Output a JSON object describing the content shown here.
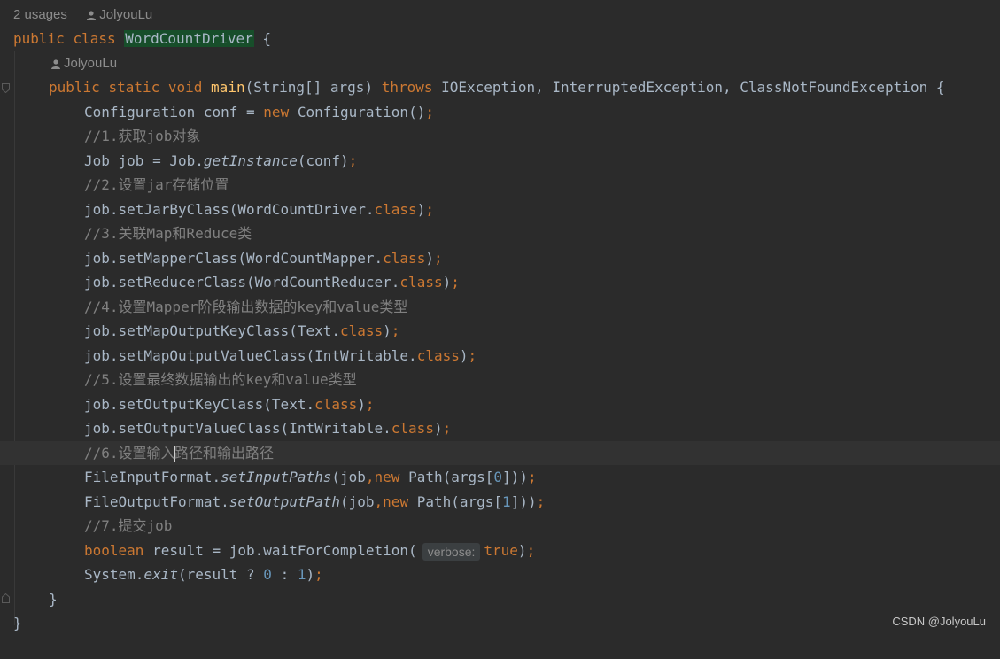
{
  "class_hint": {
    "usages": "2 usages",
    "author": "JolyouLu"
  },
  "method_hint": {
    "author": "JolyouLu"
  },
  "code": {
    "class_decl": {
      "kw1": "public",
      "kw2": "class",
      "name": "WordCountDriver",
      "brace": " {"
    },
    "main_decl": {
      "kw1": "public",
      "kw2": "static",
      "kw3": "void",
      "name": "main",
      "params": "(String[] args) ",
      "throws": "throws",
      "exceptions": " IOException, InterruptedException, ClassNotFoundException {"
    },
    "l_conf": {
      "a": "Configuration conf = ",
      "kw": "new",
      "b": " Configuration()",
      "semi": ";"
    },
    "c1": "//1.获取job对象",
    "l_job": {
      "a": "Job job = Job.",
      "method": "getInstance",
      "b": "(conf)",
      "semi": ";"
    },
    "c2": "//2.设置jar存储位置",
    "l_jar": {
      "a": "job.setJarByClass(WordCountDriver.",
      "kw": "class",
      "b": ")",
      "semi": ";"
    },
    "c3": "//3.关联Map和Reduce类",
    "l_mapper": {
      "a": "job.setMapperClass(WordCountMapper.",
      "kw": "class",
      "b": ")",
      "semi": ";"
    },
    "l_reducer": {
      "a": "job.setReducerClass(WordCountReducer.",
      "kw": "class",
      "b": ")",
      "semi": ";"
    },
    "c4": "//4.设置Mapper阶段输出数据的key和value类型",
    "l_mok": {
      "a": "job.setMapOutputKeyClass(Text.",
      "kw": "class",
      "b": ")",
      "semi": ";"
    },
    "l_mov": {
      "a": "job.setMapOutputValueClass(IntWritable.",
      "kw": "class",
      "b": ")",
      "semi": ";"
    },
    "c5": "//5.设置最终数据输出的key和value类型",
    "l_ok": {
      "a": "job.setOutputKeyClass(Text.",
      "kw": "class",
      "b": ")",
      "semi": ";"
    },
    "l_ov": {
      "a": "job.setOutputValueClass(IntWritable.",
      "kw": "class",
      "b": ")",
      "semi": ";"
    },
    "c6a": "//6.设置输入",
    "c6b": "路径和输出路径",
    "l_in": {
      "a": "FileInputFormat.",
      "method": "setInputPaths",
      "b": "(job",
      "comma": ",",
      "kw": "new",
      "c": " Path(args[",
      "num": "0",
      "d": "]))",
      "semi": ";"
    },
    "l_out": {
      "a": "FileOutputFormat.",
      "method": "setOutputPath",
      "b": "(job",
      "comma": ",",
      "kw": "new",
      "c": " Path(args[",
      "num": "1",
      "d": "]))",
      "semi": ";"
    },
    "c7": "//7.提交job",
    "l_wait": {
      "kw": "boolean",
      "a": " result = job.waitForCompletion(",
      "hint": "verbose:",
      "val": "true",
      "b": ")",
      "semi": ";"
    },
    "l_exit": {
      "a": "System.",
      "method": "exit",
      "b": "(result ? ",
      "n0": "0",
      "mid": " : ",
      "n1": "1",
      "c": ")",
      "semi": ";"
    },
    "close_method": "}",
    "close_class": "}"
  },
  "watermark": "CSDN @JolyouLu",
  "colors": {
    "background": "#2b2b2b",
    "keyword": "#cc7832",
    "method": "#ffc66d",
    "comment": "#808080",
    "number": "#6897bb"
  }
}
